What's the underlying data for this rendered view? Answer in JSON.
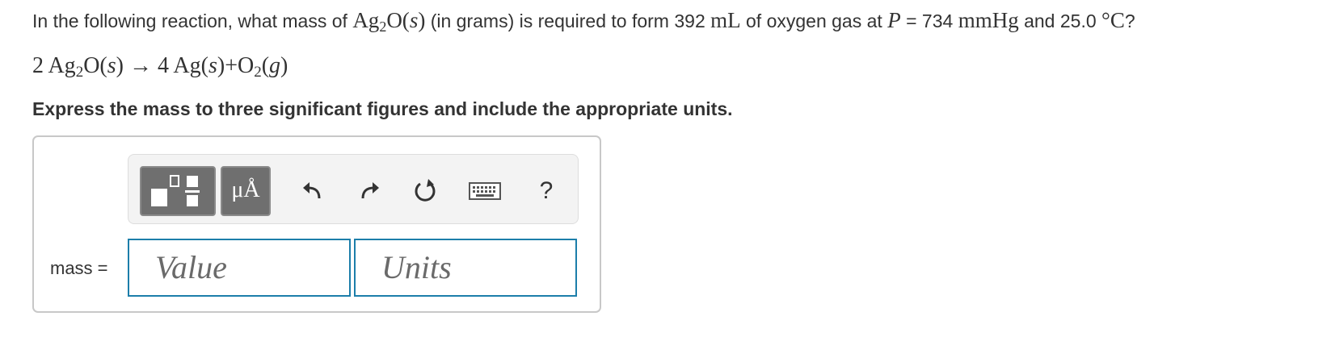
{
  "question": {
    "prefix": "In the following reaction, what mass of ",
    "compound_main": "Ag",
    "compound_sub": "2",
    "compound_rest": "O(",
    "compound_state": "s",
    "compound_close": ")",
    "mid": " (in grams) is required to form 392 ",
    "volume_unit": "mL",
    "after_unit": " of oxygen gas at ",
    "pressure_symbol": "P",
    "pressure_value": " = 734 ",
    "pressure_unit": "mmHg",
    "temp_text": " and 25.0 ",
    "temp_unit": "°C",
    "end": "?"
  },
  "equation": {
    "part1": "2 Ag",
    "sub1": "2",
    "part2": "O(",
    "state1": "s",
    "part3": ") → 4 Ag(",
    "state2": "s",
    "part4": ")+O",
    "sub2": "2",
    "part5": "(",
    "state3": "g",
    "part6": ")"
  },
  "instruction": "Express the mass to three significant figures and include the appropriate units.",
  "toolbar": {
    "units_label": "μÅ",
    "help_label": "?",
    "icons": [
      "templates-icon",
      "units-icon",
      "undo-icon",
      "redo-icon",
      "reset-icon",
      "keyboard-icon",
      "help-icon"
    ]
  },
  "answer": {
    "label": "mass =",
    "value_placeholder": "Value",
    "units_placeholder": "Units"
  },
  "colors": {
    "field_border": "#1c7eaa",
    "toolbar_button": "#6f6f6f"
  }
}
